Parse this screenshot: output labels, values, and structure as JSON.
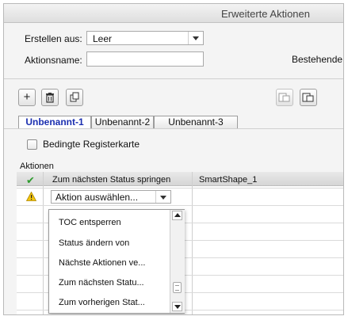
{
  "window": {
    "title": "Erweiterte Aktionen"
  },
  "form": {
    "create_from_label": "Erstellen aus:",
    "create_from_value": "Leer",
    "action_name_label": "Aktionsname:",
    "action_name_value": "",
    "existing_label": "Bestehende"
  },
  "toolbar": {
    "add_icon": "plus-icon",
    "delete_icon": "trash-icon",
    "duplicate_icon": "duplicate-icon",
    "copy_icon": "copy-icon",
    "paste_icon": "paste-icon"
  },
  "tabs": [
    {
      "label": "Unbenannt-1",
      "active": true
    },
    {
      "label": "Unbenannt-2",
      "active": false
    },
    {
      "label": "Unbenannt-3",
      "active": false
    }
  ],
  "conditional_tab_label": "Bedingte Registerkarte",
  "actions": {
    "header": "Aktionen",
    "rows": [
      {
        "status_icon": "check-icon",
        "action": "Zum nächsten Status springen",
        "target": "SmartShape_1"
      },
      {
        "status_icon": "warning-icon",
        "action": "Aktion auswählen...",
        "target": ""
      }
    ]
  },
  "dropdown": {
    "items": [
      "TOC entsperren",
      "Status ändern von",
      "Nächste Aktionen ve...",
      "Zum nächsten Statu...",
      "Zum vorherigen Stat..."
    ]
  },
  "colors": {
    "active_tab_text": "#1b2fb0",
    "check": "#2e9b2e",
    "warning": "#e6b400"
  }
}
